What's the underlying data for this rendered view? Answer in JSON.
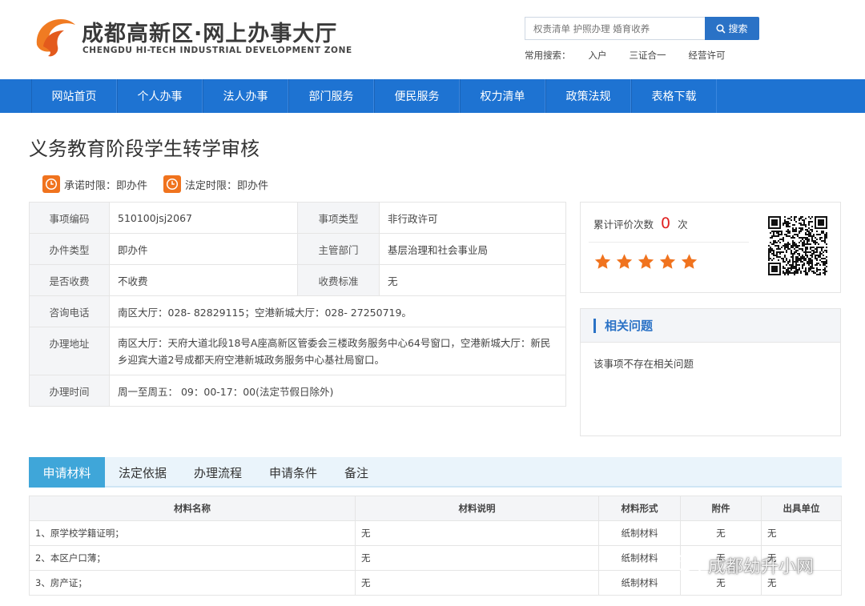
{
  "header": {
    "title": "成都高新区·网上办事大厅",
    "subtitle": "CHENGDU HI-TECH INDUSTRIAL DEVELOPMENT ZONE",
    "search_placeholder": "权责清单 护照办理 婚育收养",
    "search_button": "搜索",
    "common_label": "常用搜索：",
    "common_links": [
      "入户",
      "三证合一",
      "经营许可"
    ]
  },
  "nav": {
    "items": [
      "网站首页",
      "个人办事",
      "法人办事",
      "部门服务",
      "便民服务",
      "权力清单",
      "政策法规",
      "表格下载"
    ]
  },
  "page": {
    "title": "义务教育阶段学生转学审核",
    "promise_limit": "承诺时限：即办件",
    "legal_limit": "法定时限：即办件"
  },
  "info": {
    "code_label": "事项编码",
    "code": "510100jsj2067",
    "type_label": "事项类型",
    "type": "非行政许可",
    "handle_type_label": "办件类型",
    "handle_type": "即办件",
    "dept_label": "主管部门",
    "dept": "基层治理和社会事业局",
    "fee_label": "是否收费",
    "fee": "不收费",
    "fee_std_label": "收费标准",
    "fee_std": "无",
    "phone_label": "咨询电话",
    "phone": "南区大厅：028- 82829115；空港新城大厅：028- 27250719。",
    "address_label": "办理地址",
    "address": "南区大厅：天府大道北段18号A座高新区管委会三楼政务服务中心64号窗口，空港新城大厅：新民乡迎宾大道2号成都天府空港新城政务服务中心基社局窗口。",
    "hours_label": "办理时间",
    "hours": "周一至周五： 09：00-17：00(法定节假日除外)"
  },
  "evaluation": {
    "label": "累计评价次数",
    "count": "0",
    "unit": "次",
    "stars": 5
  },
  "faq": {
    "title": "相关问题",
    "body": "该事项不存在相关问题"
  },
  "tabs": [
    "申请材料",
    "法定依据",
    "办理流程",
    "申请条件",
    "备注"
  ],
  "materials": {
    "headers": [
      "材料名称",
      "材料说明",
      "材料形式",
      "附件",
      "出具单位"
    ],
    "rows": [
      {
        "name": "1、原学校学籍证明；",
        "desc": "无",
        "form": "纸制材料",
        "attach": "无",
        "issuer": "无"
      },
      {
        "name": "2、本区户口薄；",
        "desc": "无",
        "form": "纸制材料",
        "attach": "无",
        "issuer": "无"
      },
      {
        "name": "3、房产证；",
        "desc": "无",
        "form": "纸制材料",
        "attach": "无",
        "issuer": "无"
      }
    ]
  },
  "watermark": "成都幼升小网",
  "colors": {
    "brand_blue": "#1e73d2",
    "accent_orange": "#f0731e",
    "tab_active": "#3fa6d9",
    "count_red": "#e02020"
  }
}
